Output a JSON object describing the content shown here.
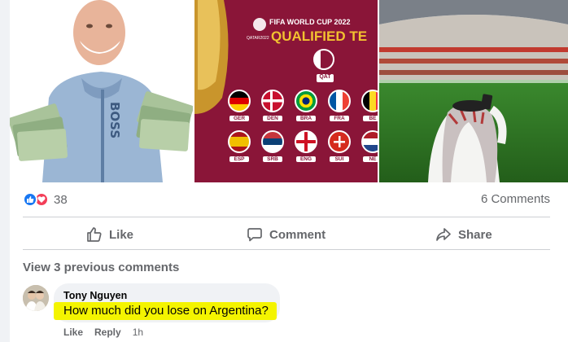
{
  "reactions": {
    "count": "38",
    "like_icon": "thumbs-up-icon",
    "love_icon": "heart-icon"
  },
  "comments_count": "6 Comments",
  "actions": {
    "like": "Like",
    "comment": "Comment",
    "share": "Share"
  },
  "view_previous": "View 3 previous comments",
  "comment": {
    "author": "Tony Nguyen",
    "text": "How much did you lose on Argentina?",
    "like": "Like",
    "reply": "Reply",
    "time": "1h"
  },
  "photos": {
    "wc_logo": "FIFA WORLD CUP 2022",
    "wc_sub": "QATAR2022",
    "banner": "QUALIFIED TE",
    "host_code": "QAT",
    "teams_row1": [
      "GER",
      "DEN",
      "BRA",
      "FRA",
      "BE"
    ],
    "teams_row2": [
      "ESP",
      "SRB",
      "ENG",
      "SUI",
      "NE"
    ]
  },
  "colors": {
    "like_blue": "#1877f2",
    "love_red": "#f33e58",
    "highlight": "#f4f400",
    "qatar_maroon": "#8a1538"
  }
}
